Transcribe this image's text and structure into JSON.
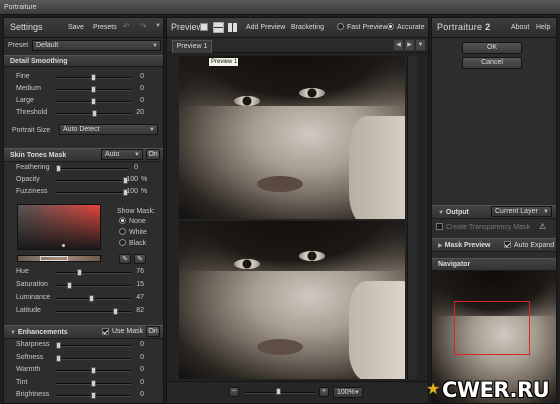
{
  "window": {
    "title": "Portraiture"
  },
  "settings": {
    "title": "Settings",
    "save_label": "Save",
    "presets_label": "Presets",
    "preset_label": "Preset",
    "preset_value": "Default",
    "detail_title": "Detail Smoothing",
    "detail_sliders": [
      {
        "label": "Fine",
        "value": "0",
        "level": 0.5
      },
      {
        "label": "Medium",
        "value": "0",
        "level": 0.5
      },
      {
        "label": "Large",
        "value": "0",
        "level": 0.5
      },
      {
        "label": "Threshold",
        "value": "20",
        "level": 0.52
      }
    ],
    "portrait_size_label": "Portrait Size",
    "portrait_size_value": "Auto Detect",
    "skin_title": "Skin Tones Mask",
    "skin_mode": "Auto",
    "skin_on": "On",
    "skin_sliders": [
      {
        "label": "Feathering",
        "value": "0",
        "suffix": "",
        "level": 0.0
      },
      {
        "label": "Opacity",
        "value": "100",
        "suffix": "%",
        "level": 1.0
      },
      {
        "label": "Fuzziness",
        "value": "100",
        "suffix": "%",
        "level": 1.0
      }
    ],
    "show_mask_label": "Show Mask:",
    "show_mask_options": [
      {
        "label": "None",
        "selected": true
      },
      {
        "label": "White",
        "selected": false
      },
      {
        "label": "Black",
        "selected": false
      }
    ],
    "color_sliders": [
      {
        "label": "Hue",
        "value": "76",
        "level": 0.3
      },
      {
        "label": "Saturation",
        "value": "15",
        "level": 0.15
      },
      {
        "label": "Luminance",
        "value": "47",
        "level": 0.47
      },
      {
        "label": "Latitude",
        "value": "82",
        "level": 0.82
      }
    ],
    "enh_title": "Enhancements",
    "use_mask_label": "Use Mask",
    "enh_on": "On",
    "enh_sliders": [
      {
        "label": "Sharpness",
        "value": "0",
        "level": 0.0
      },
      {
        "label": "Softness",
        "value": "0",
        "level": 0.0
      },
      {
        "label": "Warmth",
        "value": "0",
        "level": 0.5
      },
      {
        "label": "Tint",
        "value": "0",
        "level": 0.5
      },
      {
        "label": "Brightness",
        "value": "0",
        "level": 0.5
      }
    ]
  },
  "preview": {
    "title": "Preview",
    "add_preview": "Add Preview",
    "bracketing": "Bracketing",
    "fast_preview": "Fast Preview",
    "accurate": "Accurate",
    "tab_label": "Preview 1",
    "tooltip": "Preview 1",
    "zoom": "100%"
  },
  "right": {
    "brand_a": "Portraiture",
    "brand_b": "2",
    "about": "About",
    "help": "Help",
    "ok": "OK",
    "cancel": "Cancel",
    "output_title": "Output",
    "output_value": "Current Layer",
    "create_transparency": "Create Transparency Mask",
    "mask_preview": "Mask Preview",
    "auto_expand": "Auto Expand",
    "navigator": "Navigator"
  },
  "watermark": "CWER.RU",
  "colors": {
    "accent": "#e8463c",
    "nav_box": "#d62828"
  }
}
